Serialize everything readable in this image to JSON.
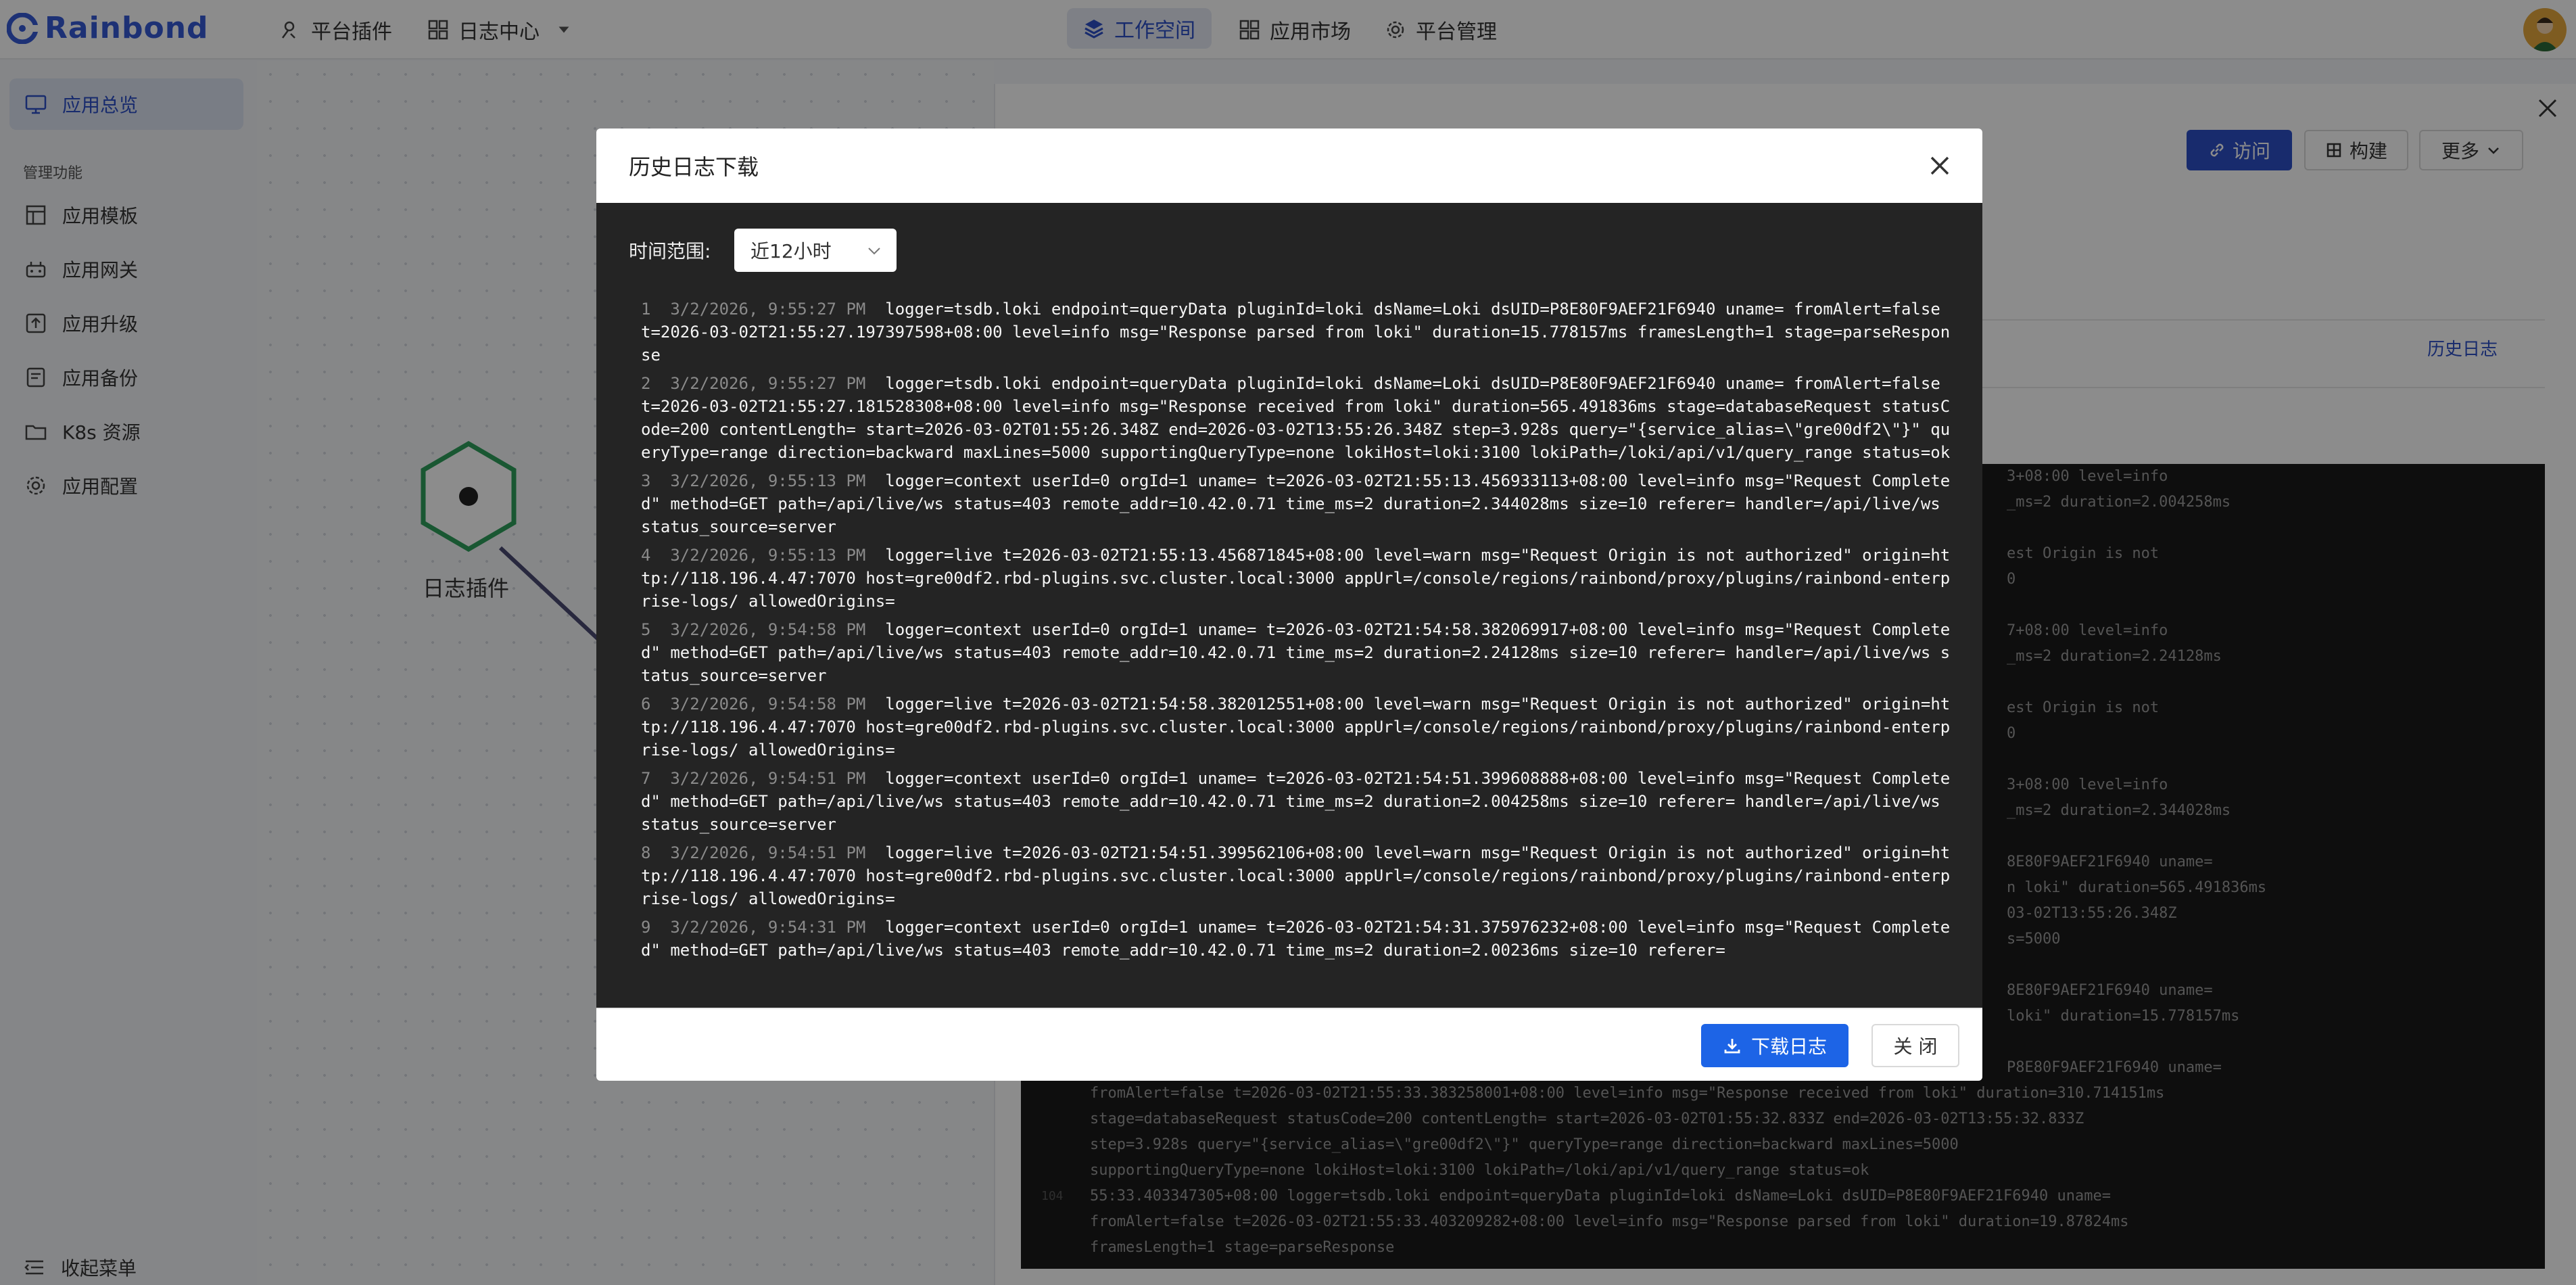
{
  "brand": {
    "name": "Rainbond"
  },
  "topnav": {
    "left": [
      {
        "label": "平台插件",
        "icon": "plugin-icon"
      },
      {
        "label": "日志中心",
        "icon": "grid-icon"
      }
    ],
    "center": [
      {
        "label": "工作空间",
        "icon": "layers-icon",
        "active": true
      },
      {
        "label": "应用市场",
        "icon": "grid-icon"
      },
      {
        "label": "平台管理",
        "icon": "gear-icon"
      }
    ]
  },
  "sidebar": {
    "overview": "应用总览",
    "section_title": "管理功能",
    "items": [
      {
        "label": "应用模板",
        "icon": "template-icon"
      },
      {
        "label": "应用网关",
        "icon": "gateway-icon"
      },
      {
        "label": "应用升级",
        "icon": "upgrade-icon"
      },
      {
        "label": "应用备份",
        "icon": "backup-icon"
      },
      {
        "label": "K8s 资源",
        "icon": "folder-icon"
      },
      {
        "label": "应用配置",
        "icon": "gear-icon"
      }
    ],
    "collapse": "收起菜单"
  },
  "canvas": {
    "node_label": "日志插件"
  },
  "panel": {
    "visit": "访问",
    "build": "构建",
    "more": "更多",
    "history_tab": "历史日志",
    "background_log": [
      {
        "n": "",
        "text": "3+08:00 level=info"
      },
      {
        "n": "",
        "text": "_ms=2 duration=2.004258ms"
      },
      {
        "n": "",
        "text": ""
      },
      {
        "n": "",
        "text": "est Origin is not"
      },
      {
        "n": "",
        "text": "0"
      },
      {
        "n": "",
        "text": ""
      },
      {
        "n": "",
        "text": "7+08:00 level=info"
      },
      {
        "n": "",
        "text": "_ms=2 duration=2.24128ms"
      },
      {
        "n": "",
        "text": ""
      },
      {
        "n": "",
        "text": "est Origin is not"
      },
      {
        "n": "",
        "text": "0"
      },
      {
        "n": "",
        "text": ""
      },
      {
        "n": "",
        "text": "3+08:00 level=info"
      },
      {
        "n": "",
        "text": "_ms=2 duration=2.344028ms"
      },
      {
        "n": "",
        "text": ""
      },
      {
        "n": "",
        "text": "8E80F9AEF21F6940 uname="
      },
      {
        "n": "",
        "text": "n loki\" duration=565.491836ms"
      },
      {
        "n": "",
        "text": "03-02T13:55:26.348Z"
      },
      {
        "n": "",
        "text": "s=5000"
      },
      {
        "n": "",
        "text": ""
      },
      {
        "n": "",
        "text": "8E80F9AEF21F6940 uname="
      },
      {
        "n": "",
        "text": "loki\" duration=15.778157ms"
      },
      {
        "n": "",
        "text": ""
      },
      {
        "n": "",
        "text": "P8E80F9AEF21F6940 uname="
      },
      {
        "n": "",
        "text": "fromAlert=false t=2026-03-02T21:55:33.383258001+08:00 level=info msg=\"Response received from loki\" duration=310.714151ms"
      },
      {
        "n": "",
        "text": "stage=databaseRequest statusCode=200 contentLength= start=2026-03-02T01:55:32.833Z end=2026-03-02T13:55:32.833Z"
      },
      {
        "n": "",
        "text": "step=3.928s query=\"{service_alias=\\\"gre00df2\\\"}\" queryType=range direction=backward maxLines=5000"
      },
      {
        "n": "",
        "text": "supportingQueryType=none lokiHost=loki:3100 lokiPath=/loki/api/v1/query_range status=ok"
      },
      {
        "n": "104",
        "text": "55:33.403347305+08:00 logger=tsdb.loki endpoint=queryData pluginId=loki dsName=Loki dsUID=P8E80F9AEF21F6940 uname="
      },
      {
        "n": "",
        "text": "fromAlert=false t=2026-03-02T21:55:33.403209282+08:00 level=info msg=\"Response parsed from loki\" duration=19.87824ms"
      },
      {
        "n": "",
        "text": "framesLength=1 stage=parseResponse"
      }
    ]
  },
  "modal": {
    "title": "历史日志下载",
    "range_label": "时间范围:",
    "range_value": "近12小时",
    "download": "下载日志",
    "close": "关 闭",
    "logs": [
      {
        "n": "1",
        "ts": "3/2/2026, 9:55:27 PM",
        "text": "logger=tsdb.loki endpoint=queryData pluginId=loki dsName=Loki dsUID=P8E80F9AEF21F6940 uname= fromAlert=false t=2026-03-02T21:55:27.197397598+08:00 level=info msg=\"Response parsed from loki\" duration=15.778157ms framesLength=1 stage=parseResponse"
      },
      {
        "n": "2",
        "ts": "3/2/2026, 9:55:27 PM",
        "text": "logger=tsdb.loki endpoint=queryData pluginId=loki dsName=Loki dsUID=P8E80F9AEF21F6940 uname= fromAlert=false t=2026-03-02T21:55:27.181528308+08:00 level=info msg=\"Response received from loki\" duration=565.491836ms stage=databaseRequest statusCode=200 contentLength= start=2026-03-02T01:55:26.348Z end=2026-03-02T13:55:26.348Z step=3.928s query=\"{service_alias=\\\"gre00df2\\\"}\" queryType=range direction=backward maxLines=5000 supportingQueryType=none lokiHost=loki:3100 lokiPath=/loki/api/v1/query_range status=ok"
      },
      {
        "n": "3",
        "ts": "3/2/2026, 9:55:13 PM",
        "text": "logger=context userId=0 orgId=1 uname= t=2026-03-02T21:55:13.456933113+08:00 level=info msg=\"Request Completed\" method=GET path=/api/live/ws status=403 remote_addr=10.42.0.71 time_ms=2 duration=2.344028ms size=10 referer= handler=/api/live/ws status_source=server"
      },
      {
        "n": "4",
        "ts": "3/2/2026, 9:55:13 PM",
        "text": "logger=live t=2026-03-02T21:55:13.456871845+08:00 level=warn msg=\"Request Origin is not authorized\" origin=http://118.196.4.47:7070 host=gre00df2.rbd-plugins.svc.cluster.local:3000 appUrl=/console/regions/rainbond/proxy/plugins/rainbond-enterprise-logs/ allowedOrigins="
      },
      {
        "n": "5",
        "ts": "3/2/2026, 9:54:58 PM",
        "text": "logger=context userId=0 orgId=1 uname= t=2026-03-02T21:54:58.382069917+08:00 level=info msg=\"Request Completed\" method=GET path=/api/live/ws status=403 remote_addr=10.42.0.71 time_ms=2 duration=2.24128ms size=10 referer= handler=/api/live/ws status_source=server"
      },
      {
        "n": "6",
        "ts": "3/2/2026, 9:54:58 PM",
        "text": "logger=live t=2026-03-02T21:54:58.382012551+08:00 level=warn msg=\"Request Origin is not authorized\" origin=http://118.196.4.47:7070 host=gre00df2.rbd-plugins.svc.cluster.local:3000 appUrl=/console/regions/rainbond/proxy/plugins/rainbond-enterprise-logs/ allowedOrigins="
      },
      {
        "n": "7",
        "ts": "3/2/2026, 9:54:51 PM",
        "text": "logger=context userId=0 orgId=1 uname= t=2026-03-02T21:54:51.399608888+08:00 level=info msg=\"Request Completed\" method=GET path=/api/live/ws status=403 remote_addr=10.42.0.71 time_ms=2 duration=2.004258ms size=10 referer= handler=/api/live/ws status_source=server"
      },
      {
        "n": "8",
        "ts": "3/2/2026, 9:54:51 PM",
        "text": "logger=live t=2026-03-02T21:54:51.399562106+08:00 level=warn msg=\"Request Origin is not authorized\" origin=http://118.196.4.47:7070 host=gre00df2.rbd-plugins.svc.cluster.local:3000 appUrl=/console/regions/rainbond/proxy/plugins/rainbond-enterprise-logs/ allowedOrigins="
      },
      {
        "n": "9",
        "ts": "3/2/2026, 9:54:31 PM",
        "text": "logger=context userId=0 orgId=1 uname= t=2026-03-02T21:54:31.375976232+08:00 level=info msg=\"Request Completed\" method=GET path=/api/live/ws status=403 remote_addr=10.42.0.71 time_ms=2 duration=2.00236ms size=10 referer="
      }
    ]
  }
}
